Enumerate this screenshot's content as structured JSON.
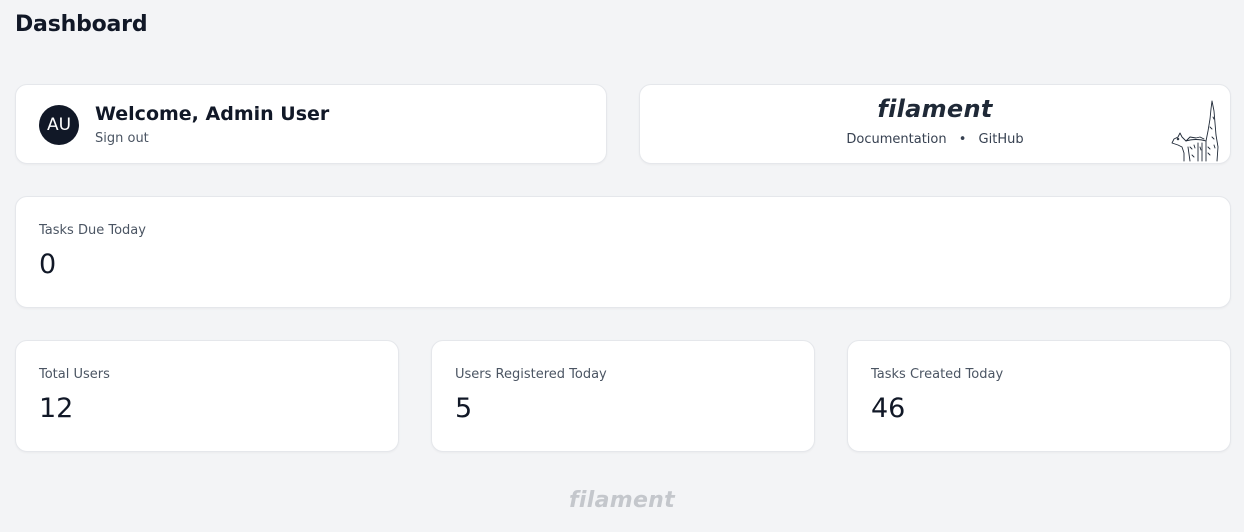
{
  "page": {
    "title": "Dashboard"
  },
  "welcome": {
    "avatar_initials": "AU",
    "title": "Welcome, Admin User",
    "sign_out_label": "Sign out"
  },
  "info": {
    "logo_text": "filament",
    "documentation_label": "Documentation",
    "separator": "•",
    "github_label": "GitHub",
    "mascot_icon": "dog-mascot-icon"
  },
  "stats": {
    "tasks_due_today": {
      "label": "Tasks Due Today",
      "value": "0"
    },
    "total_users": {
      "label": "Total Users",
      "value": "12"
    },
    "users_registered_today": {
      "label": "Users Registered Today",
      "value": "5"
    },
    "tasks_created_today": {
      "label": "Tasks Created Today",
      "value": "46"
    }
  },
  "footer": {
    "logo_text": "filament"
  },
  "colors": {
    "background": "#f3f4f6",
    "card": "#ffffff",
    "text_primary": "#111827",
    "text_secondary": "#4b5563",
    "avatar_bg": "#111827",
    "footer_logo": "#c4c7cc"
  }
}
